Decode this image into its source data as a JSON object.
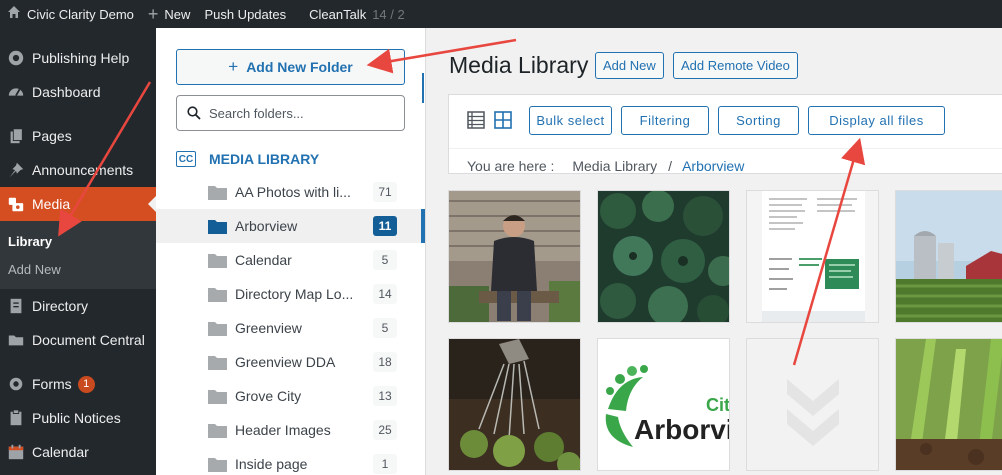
{
  "adminbar": {
    "site_name": "Civic Clarity Demo",
    "new_label": "New",
    "push_updates": "Push Updates",
    "cleantalk_label": "CleanTalk",
    "cleantalk_count": "14 / 2"
  },
  "sidebar": {
    "items": [
      {
        "label": "Publishing Help",
        "icon": "help-icon"
      },
      {
        "label": "Dashboard",
        "icon": "dashboard-icon"
      },
      {
        "label": "Pages",
        "icon": "pages-icon"
      },
      {
        "label": "Announcements",
        "icon": "pin-icon"
      },
      {
        "label": "Media",
        "icon": "media-icon"
      },
      {
        "label": "Directory",
        "icon": "directory-icon"
      },
      {
        "label": "Document Central",
        "icon": "folder-icon"
      },
      {
        "label": "Forms",
        "icon": "forms-icon",
        "badge": "1"
      },
      {
        "label": "Public Notices",
        "icon": "notices-icon"
      },
      {
        "label": "Calendar",
        "icon": "calendar-icon"
      }
    ],
    "media_submenu": [
      "Library",
      "Add New"
    ]
  },
  "folders": {
    "add_button": "Add New Folder",
    "search_placeholder": "Search folders...",
    "root_label": "MEDIA LIBRARY",
    "root_icon_text": "CC",
    "list": [
      {
        "name": "AA Photos with li...",
        "count": "71"
      },
      {
        "name": "Arborview",
        "count": "11",
        "selected": true
      },
      {
        "name": "Calendar",
        "count": "5"
      },
      {
        "name": "Directory Map Lo...",
        "count": "14"
      },
      {
        "name": "Greenview",
        "count": "5"
      },
      {
        "name": "Greenview DDA",
        "count": "18"
      },
      {
        "name": "Grove City",
        "count": "13"
      },
      {
        "name": "Header Images",
        "count": "25"
      },
      {
        "name": "Inside page",
        "count": "1"
      }
    ]
  },
  "main": {
    "title": "Media Library",
    "add_new": "Add New",
    "add_remote_video": "Add Remote Video",
    "bulk_select": "Bulk select",
    "filtering": "Filtering",
    "sorting": "Sorting",
    "display_all": "Display all files",
    "crumb_prefix": "You are here :",
    "crumb_root": "Media Library",
    "crumb_sep": "/",
    "crumb_current": "Arborview",
    "thumb_logo_text_1": "City",
    "thumb_logo_text_2": "Arborvie"
  },
  "colors": {
    "accent": "#2271b1",
    "sidebar_bg": "#23282d",
    "active_menu": "#d54e21",
    "annotation_arrow": "#e8473f"
  }
}
